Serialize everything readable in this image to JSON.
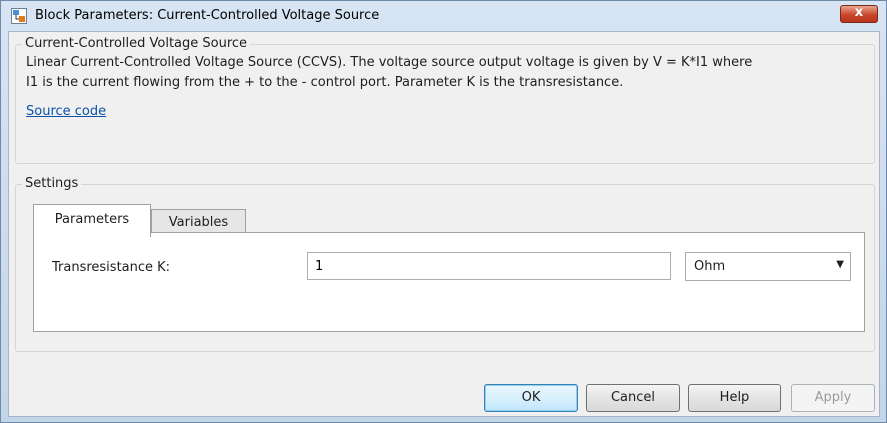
{
  "window": {
    "title": "Block Parameters: Current-Controlled Voltage Source",
    "close_label": "x"
  },
  "block": {
    "group_title": "Current-Controlled Voltage Source",
    "description_line1": "Linear Current-Controlled Voltage Source (CCVS). The voltage source output voltage is given by V = K*I1 where",
    "description_line2": "I1 is the current flowing from the + to the - control port. Parameter K is the transresistance.",
    "source_link": "Source code"
  },
  "settings": {
    "group_title": "Settings",
    "tabs": [
      {
        "label": "Parameters",
        "active": true
      },
      {
        "label": "Variables",
        "active": false
      }
    ],
    "params": {
      "transresistance_label": "Transresistance K:",
      "transresistance_value": "1",
      "unit_value": "Ohm"
    }
  },
  "buttons": {
    "ok": "OK",
    "cancel": "Cancel",
    "help": "Help",
    "apply": "Apply"
  },
  "colors": {
    "link": "#0b52a8",
    "close": "#c9462b",
    "ok_border": "#3c7fb1"
  }
}
